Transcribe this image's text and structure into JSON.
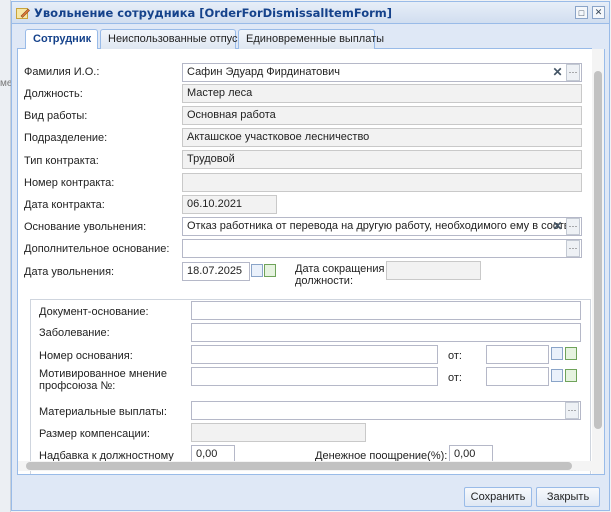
{
  "window": {
    "title": "Увольнение сотрудника [OrderForDismissalItemForm]"
  },
  "background": {
    "side_text": "ме"
  },
  "tabs": [
    {
      "label": "Сотрудник"
    },
    {
      "label": "Неиспользованные отпуска"
    },
    {
      "label": "Единовременные выплаты"
    }
  ],
  "form": {
    "fio": {
      "label": "Фамилия И.О.:",
      "value": "Сафин Эдуард Фирдинатович"
    },
    "position": {
      "label": "Должность:",
      "value": "Мастер леса"
    },
    "work_type": {
      "label": "Вид работы:",
      "value": "Основная работа"
    },
    "subdivision": {
      "label": "Подразделение:",
      "value": "Акташское участковое лесничество"
    },
    "contract_type": {
      "label": "Тип контракта:",
      "value": "Трудовой"
    },
    "contract_number": {
      "label": "Номер контракта:",
      "value": ""
    },
    "contract_date": {
      "label": "Дата контракта:",
      "value": "06.10.2021"
    },
    "dismissal_reason": {
      "label": "Основание увольнения:",
      "value": "Отказ работника от перевода на другую работу, необходимого ему в соотве"
    },
    "additional_reason": {
      "label": "Дополнительное основание:",
      "value": ""
    },
    "dismissal_date": {
      "label": "Дата увольнения:",
      "value": "18.07.2025"
    },
    "reduction_date": {
      "label": "Дата сокращения должности:",
      "value": ""
    }
  },
  "group": {
    "basis_document": {
      "label": "Документ-основание:",
      "value": ""
    },
    "disease": {
      "label": "Заболевание:",
      "value": ""
    },
    "basis_number": {
      "label": "Номер основания:",
      "value": "",
      "from_label": "от:",
      "from_value": ""
    },
    "union_opinion": {
      "label": "Мотивированное мнение профсоюза №:",
      "value": "",
      "from_label": "от:",
      "from_value": ""
    },
    "material_payments": {
      "label": "Материальные выплаты:",
      "value": ""
    },
    "compensation": {
      "label": "Размер компенсации:",
      "value": ""
    },
    "salary_bonus": {
      "label": "Надбавка к должностному",
      "value": "0,00"
    },
    "cash_bonus": {
      "label": "Денежное поощрение(%):",
      "value": "0,00"
    }
  },
  "buttons": {
    "save": "Сохранить",
    "close": "Закрыть"
  }
}
